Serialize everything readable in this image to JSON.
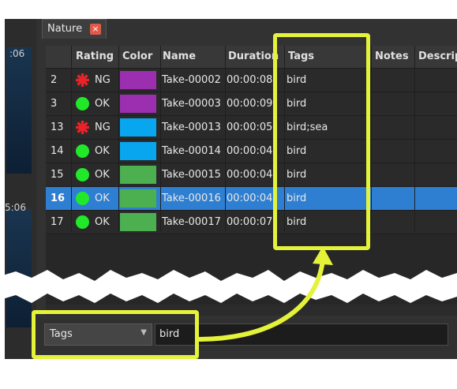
{
  "left_panel": {
    "timecode_top": ":06",
    "timecode_bottom": "5:06"
  },
  "tab": {
    "label": "Nature",
    "close_glyph": "×"
  },
  "table": {
    "columns": [
      "Rating",
      "Color",
      "Name",
      "Duration",
      "Tags",
      "Notes",
      "Descrip"
    ],
    "rows": [
      {
        "num": "2",
        "rating": "NG",
        "color": "#9c2fb0",
        "name": "Take-00002",
        "duration": "00:00:08",
        "tags": "bird",
        "selected": false
      },
      {
        "num": "3",
        "rating": "OK",
        "color": "#9c2fb0",
        "name": "Take-00003",
        "duration": "00:00:09",
        "tags": "bird",
        "selected": false
      },
      {
        "num": "13",
        "rating": "NG",
        "color": "#09a6f0",
        "name": "Take-00013",
        "duration": "00:00:05",
        "tags": "bird;sea",
        "selected": false
      },
      {
        "num": "14",
        "rating": "OK",
        "color": "#09a6f0",
        "name": "Take-00014",
        "duration": "00:00:04",
        "tags": "bird",
        "selected": false
      },
      {
        "num": "15",
        "rating": "OK",
        "color": "#4caf50",
        "name": "Take-00015",
        "duration": "00:00:04",
        "tags": "bird",
        "selected": false
      },
      {
        "num": "16",
        "rating": "OK",
        "color": "#4caf50",
        "name": "Take-00016",
        "duration": "00:00:04",
        "tags": "bird",
        "selected": true
      },
      {
        "num": "17",
        "rating": "OK",
        "color": "#4caf50",
        "name": "Take-00017",
        "duration": "00:00:07",
        "tags": "bird",
        "selected": false
      }
    ]
  },
  "filter": {
    "field": "Tags",
    "value": "bird"
  },
  "colors": {
    "ok": "#22e82a",
    "ng": "#e8232a",
    "highlight": "#e4f23a",
    "selected_row": "#2e7fd1"
  }
}
